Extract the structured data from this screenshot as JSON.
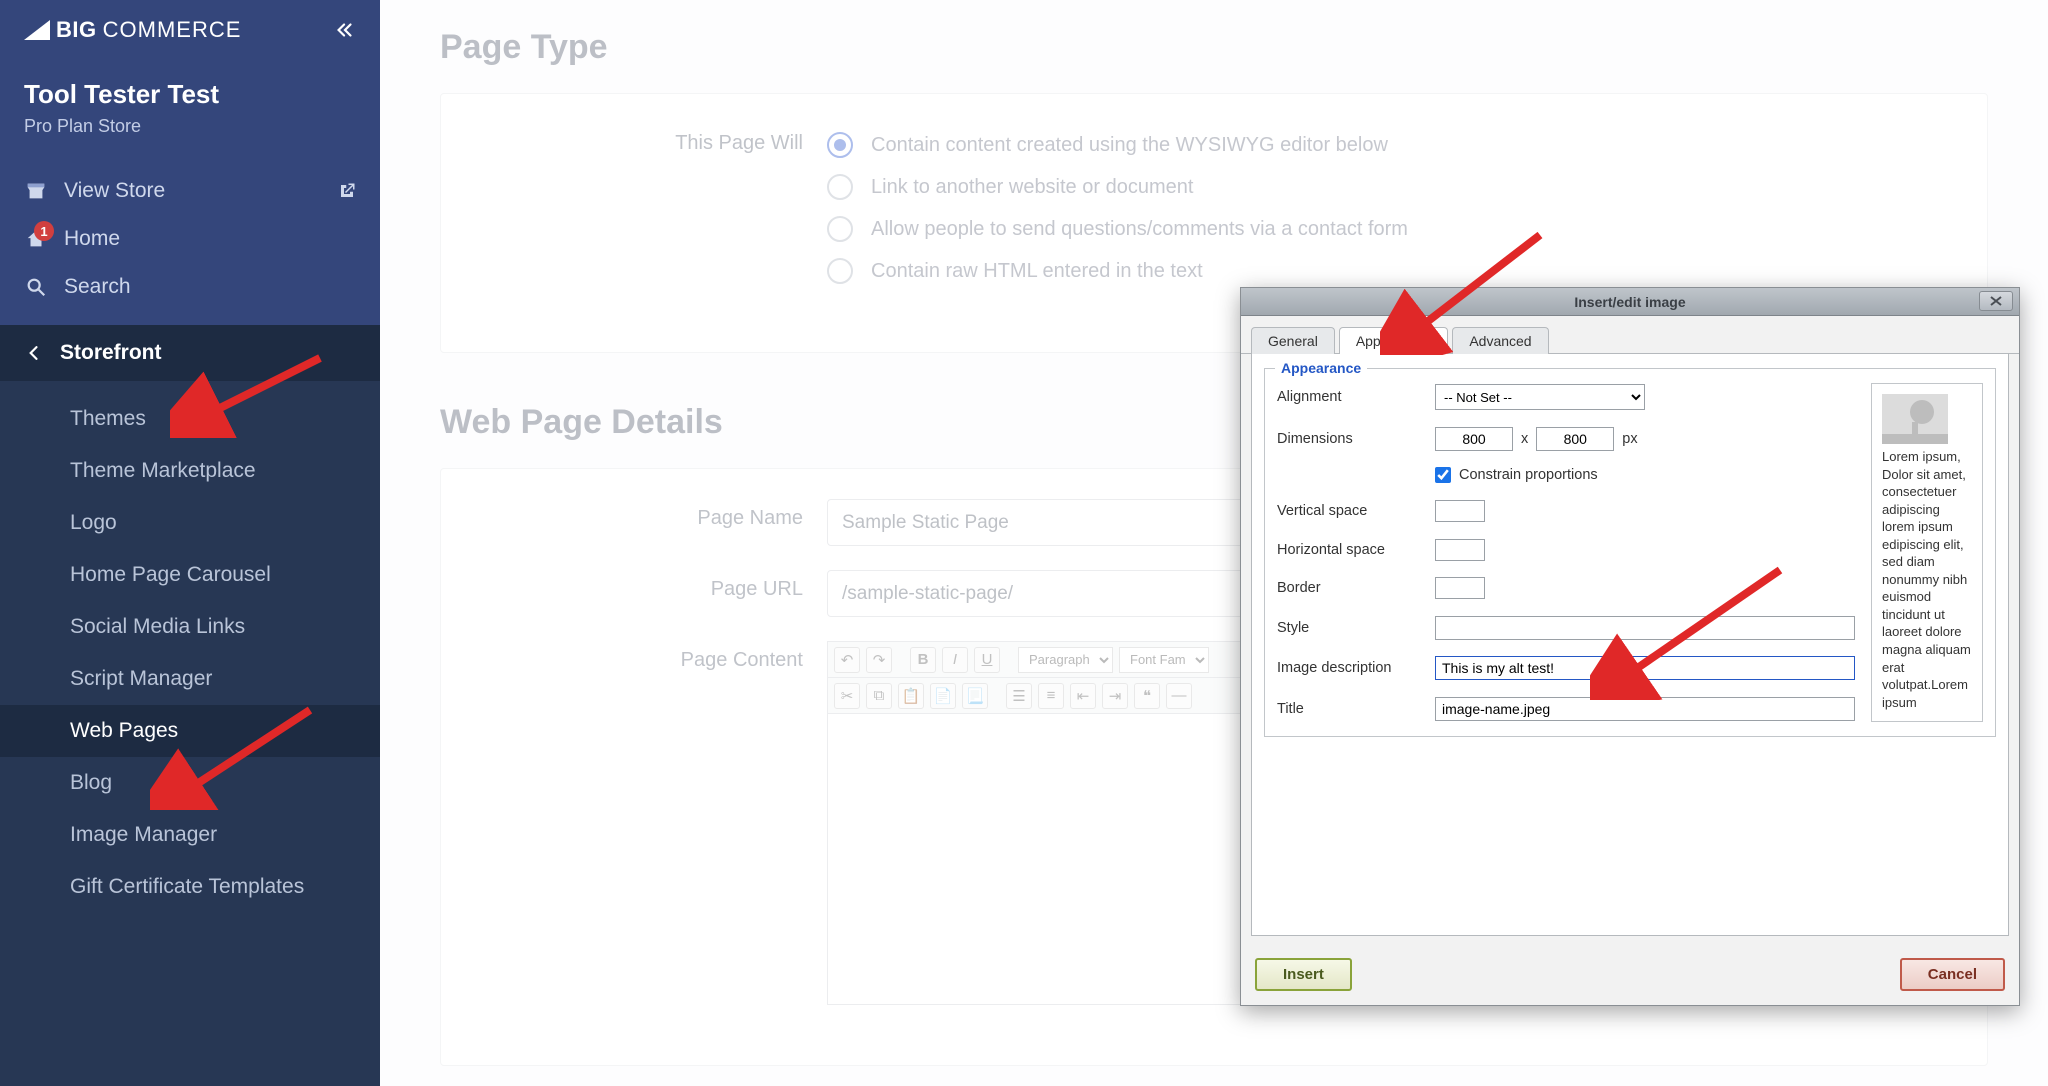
{
  "brand": {
    "name": "BIGCOMMERCE"
  },
  "store": {
    "name": "Tool Tester Test",
    "plan": "Pro Plan Store"
  },
  "nav": {
    "view_store": "View Store",
    "home": "Home",
    "home_badge": "1",
    "search": "Search"
  },
  "section": {
    "title": "Storefront"
  },
  "subnav": [
    {
      "label": "Themes",
      "active": false
    },
    {
      "label": "Theme Marketplace",
      "active": false
    },
    {
      "label": "Logo",
      "active": false
    },
    {
      "label": "Home Page Carousel",
      "active": false
    },
    {
      "label": "Social Media Links",
      "active": false
    },
    {
      "label": "Script Manager",
      "active": false
    },
    {
      "label": "Web Pages",
      "active": true
    },
    {
      "label": "Blog",
      "active": false
    },
    {
      "label": "Image Manager",
      "active": false
    },
    {
      "label": "Gift Certificate Templates",
      "active": false
    }
  ],
  "page_type": {
    "heading": "Page Type",
    "label": "This Page Will",
    "options": [
      "Contain content created using the WYSIWYG editor below",
      "Link to another website or document",
      "Allow people to send questions/comments via a contact form",
      "Contain raw HTML entered in the text"
    ],
    "selected_index": 0
  },
  "details": {
    "heading": "Web Page Details",
    "page_name": {
      "label": "Page Name",
      "value": "Sample Static Page"
    },
    "page_url": {
      "label": "Page URL",
      "value": "/sample-static-page/"
    },
    "page_content_label": "Page Content"
  },
  "toolbar": {
    "paragraph": "Paragraph",
    "font_family": "Font Fam"
  },
  "dialog": {
    "title": "Insert/edit image",
    "tabs": {
      "general": "General",
      "appearance": "Appearance",
      "advanced": "Advanced"
    },
    "legend": "Appearance",
    "labels": {
      "alignment": "Alignment",
      "dimensions": "Dimensions",
      "constrain": "Constrain proportions",
      "vspace": "Vertical space",
      "hspace": "Horizontal space",
      "border": "Border",
      "style": "Style",
      "desc": "Image description",
      "title_f": "Title"
    },
    "values": {
      "alignment": "-- Not Set --",
      "dim_w": "800",
      "dim_h": "800",
      "dim_unit": "px",
      "dim_sep": "x",
      "constrain": true,
      "vspace": "",
      "hspace": "",
      "border": "",
      "style": "",
      "desc": "This is my alt test!",
      "title_f": "image-name.jpeg"
    },
    "preview_text": "Lorem ipsum, Dolor sit amet, consectetuer adipiscing lorem ipsum edipiscing elit, sed diam nonummy nibh euismod tincidunt ut laoreet dolore magna aliquam erat volutpat.Lorem ipsum",
    "buttons": {
      "insert": "Insert",
      "cancel": "Cancel"
    }
  }
}
